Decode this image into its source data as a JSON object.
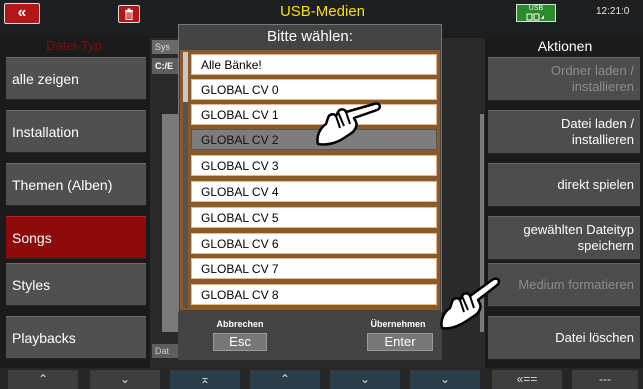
{
  "header": {
    "back_icon_label": "«",
    "title": "USB-Medien",
    "usb_badge": "USB",
    "clock": "12:21:0"
  },
  "left": {
    "heading": "Datei-Typ",
    "items": [
      {
        "label": "alle zeigen"
      },
      {
        "label": "Installation"
      },
      {
        "label": "Themen (Alben)"
      },
      {
        "label": "Songs"
      },
      {
        "label": "Styles"
      },
      {
        "label": "Playbacks"
      }
    ],
    "active_index": 3
  },
  "right": {
    "heading": "Aktionen",
    "items": [
      {
        "line1": "Ordner laden  /",
        "line2": "installieren",
        "enabled": false
      },
      {
        "line1": "Datei laden  /",
        "line2": "installieren",
        "enabled": true
      },
      {
        "line1": "direkt spielen",
        "line2": "",
        "enabled": true
      },
      {
        "line1": "gewählten Dateityp",
        "line2": "speichern",
        "enabled": true
      },
      {
        "line1": "Medium formatieren",
        "line2": "",
        "enabled": false
      },
      {
        "line1": "Datei löschen",
        "line2": "",
        "enabled": true
      }
    ]
  },
  "background_panel": {
    "tab_label": "Sys",
    "path": "C:/E",
    "footer_label": "Dat"
  },
  "dialog": {
    "title": "Bitte wählen:",
    "items": [
      "Alle Bänke!",
      "GLOBAL CV 0",
      "GLOBAL CV 1",
      "GLOBAL CV 2",
      "GLOBAL CV 3",
      "GLOBAL CV 4",
      "GLOBAL CV 5",
      "GLOBAL CV 6",
      "GLOBAL CV 7",
      "GLOBAL CV 8"
    ],
    "selected_index": 3,
    "cancel_caption": "Abbrechen",
    "cancel_button": "Esc",
    "confirm_caption": "Übernehmen",
    "confirm_button": "Enter"
  },
  "bottom": {
    "buttons": [
      "⌃",
      "⌄",
      "⌅",
      "⌃",
      "⌄",
      "⌄",
      "«==",
      "---"
    ]
  },
  "colors": {
    "accent_red": "#8e0b0b",
    "title_yellow": "#f5e000",
    "dialog_frame": "#8a5a2a"
  }
}
